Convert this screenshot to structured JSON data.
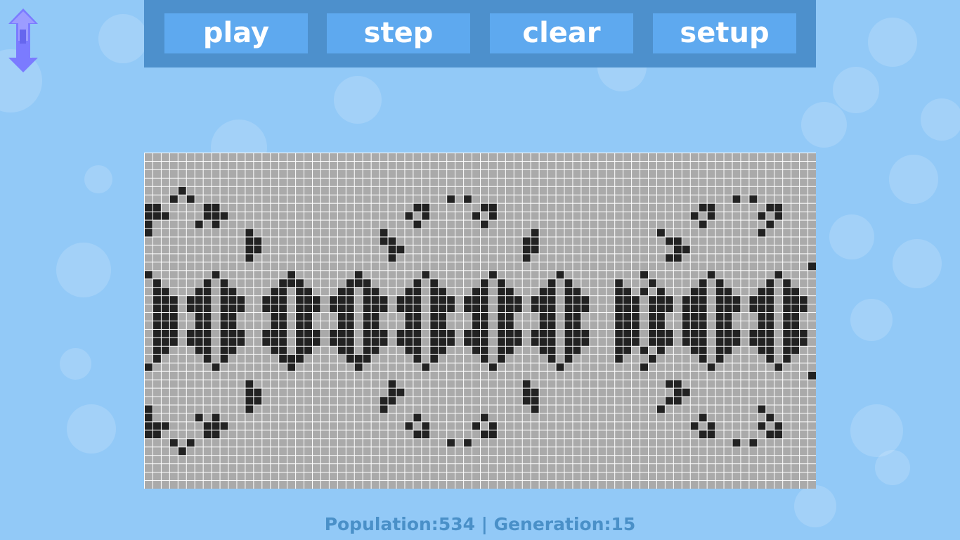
{
  "toolbar": {
    "play_label": "play",
    "step_label": "step",
    "clear_label": "clear",
    "setup_label": "setup"
  },
  "status": {
    "population_label": "Population:",
    "population": "534",
    "separator": "|",
    "generation_label": "Generation:",
    "generation": "15"
  },
  "grid": {
    "columns": 80,
    "rows": 40,
    "dead_color": "#aaaaaa",
    "live_color": "#222222",
    "line_color": "#ffffff"
  },
  "icons": {
    "scroll_arrows": "up-down-arrow-icon"
  },
  "colors": {
    "background": "#92c9f7",
    "toolbar": "#4d90cc",
    "button": "#5ea9ef",
    "button_text": "#ffffff",
    "status_text": "#4a90c8",
    "arrow": "#7b7bff"
  }
}
